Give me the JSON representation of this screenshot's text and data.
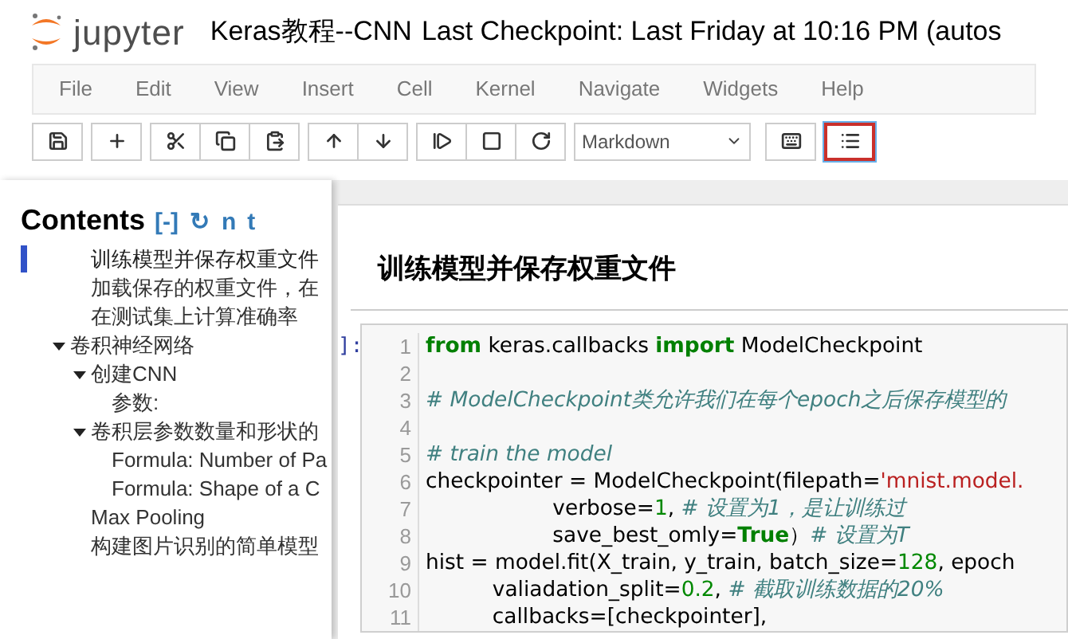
{
  "header": {
    "logo_text": "jupyter",
    "notebook_name": "Keras教程--CNN",
    "checkpoint": "Last Checkpoint: Last Friday at 10:16 PM (autos"
  },
  "menu": [
    "File",
    "Edit",
    "View",
    "Insert",
    "Cell",
    "Kernel",
    "Navigate",
    "Widgets",
    "Help"
  ],
  "toolbar": {
    "groups": [
      [
        {
          "active": false
        }
      ],
      [
        {
          "active": false
        }
      ],
      [
        {
          "active": false
        },
        {
          "active": false
        },
        {
          "active": false
        }
      ],
      [
        {
          "active": false
        },
        {
          "active": false
        }
      ],
      [
        {
          "active": false
        },
        {
          "active": false
        },
        {
          "active": false
        }
      ]
    ],
    "cell_type": "Markdown",
    "keyboard": {
      "active": false
    },
    "toc_button": {
      "active": true
    }
  },
  "toc": {
    "title": "Contents",
    "links": [
      "[-]",
      "↻",
      "n",
      "t"
    ],
    "items": [
      {
        "label": "训练模型并保存权重文件",
        "selected": true
      },
      {
        "label": "加载保存的权重文件，在",
        "selected": false
      },
      {
        "label": "在测试集上计算准确率",
        "selected": false
      },
      {
        "label": "卷积神经网络",
        "selected": false,
        "expanded": true,
        "children": [
          {
            "label": "创建CNN",
            "selected": false,
            "expanded": true,
            "children": [
              {
                "label": "参数:",
                "selected": false
              }
            ]
          },
          {
            "label": "卷积层参数数量和形状的",
            "selected": false,
            "expanded": true,
            "children": [
              {
                "label": "Formula: Number of Pa",
                "selected": false
              },
              {
                "label": "Formula: Shape of a C",
                "selected": false
              }
            ]
          },
          {
            "label": "Max Pooling",
            "selected": false
          },
          {
            "label": "构建图片识别的简单模型",
            "selected": false
          }
        ]
      }
    ]
  },
  "notebook": {
    "heading": "训练模型并保存权重文件",
    "prompt": "]:",
    "code_lines": [
      {
        "number": "1",
        "tokens": [
          {
            "kind": "kw",
            "text": "from"
          },
          {
            "kind": "plain",
            "text": " keras.callbacks "
          },
          {
            "kind": "kw",
            "text": "import"
          },
          {
            "kind": "plain",
            "text": " ModelCheckpoint"
          }
        ]
      },
      {
        "number": "2"
      },
      {
        "number": "3",
        "tokens": [
          {
            "kind": "comment",
            "text": "# ModelCheckpoint类允许我们在每个epoch之后保存模型的"
          }
        ]
      },
      {
        "number": "4"
      },
      {
        "number": "5",
        "tokens": [
          {
            "kind": "comment",
            "text": "# train the model"
          }
        ]
      },
      {
        "number": "6",
        "tokens": [
          {
            "kind": "plain",
            "text": "checkpointer = ModelCheckpoint(filepath="
          },
          {
            "kind": "str",
            "text": "'mnist.model."
          }
        ]
      },
      {
        "number": "7",
        "tokens": [
          {
            "kind": "plain",
            "text": "                   verbose="
          },
          {
            "kind": "num",
            "text": "1"
          },
          {
            "kind": "plain",
            "text": ", "
          },
          {
            "kind": "comment",
            "text": "# 设置为1，是让训练过"
          }
        ]
      },
      {
        "number": "8",
        "tokens": [
          {
            "kind": "plain",
            "text": "                   save_best_omly="
          },
          {
            "kind": "kw",
            "text": "True"
          },
          {
            "kind": "plain",
            "text": "）"
          },
          {
            "kind": "comment",
            "text": "# 设置为T"
          }
        ]
      },
      {
        "number": "9",
        "tokens": [
          {
            "kind": "plain",
            "text": "hist = model.fit(X_train, y_train, batch_size="
          },
          {
            "kind": "num",
            "text": "128"
          },
          {
            "kind": "plain",
            "text": ", epoch"
          }
        ]
      },
      {
        "number": "10",
        "tokens": [
          {
            "kind": "plain",
            "text": "          valiadation_split="
          },
          {
            "kind": "num",
            "text": "0.2"
          },
          {
            "kind": "plain",
            "text": ", "
          },
          {
            "kind": "comment",
            "text": "# 截取训练数据的20%"
          }
        ]
      },
      {
        "number": "11",
        "tokens": [
          {
            "kind": "plain",
            "text": "          callbacks=[checkpointer],"
          }
        ]
      }
    ]
  }
}
